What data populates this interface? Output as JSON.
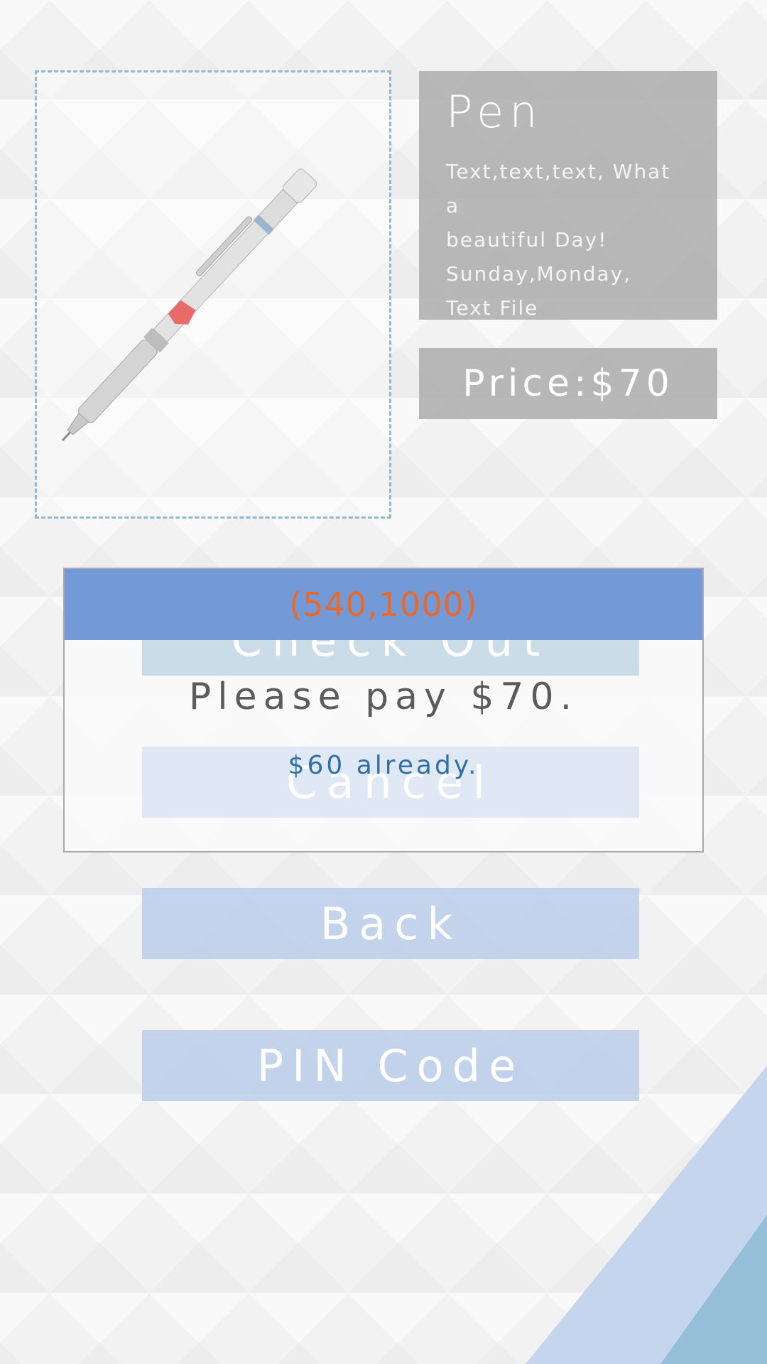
{
  "product": {
    "title": "Pen",
    "description": "Text,text,text, What a\nbeautiful Day!\nSunday,Monday,\nText File",
    "price_label": "Price:$70",
    "image_icon": "mechanical-pencil-image"
  },
  "dialog": {
    "header": "(540,1000)",
    "hidden_button_checkout": "Check Out",
    "message": "Please pay $70.",
    "sub_message": "$60 already.",
    "hidden_button_cancel": "Cancel"
  },
  "buttons": {
    "back": "Back",
    "pin": "PIN Code"
  },
  "colors": {
    "dialog_header": "#739ad7",
    "header_text": "#e8692a",
    "button_fill": "#b7cae8",
    "panel_gray": "#aaaaaa",
    "frame_border": "#8fb8d6"
  }
}
